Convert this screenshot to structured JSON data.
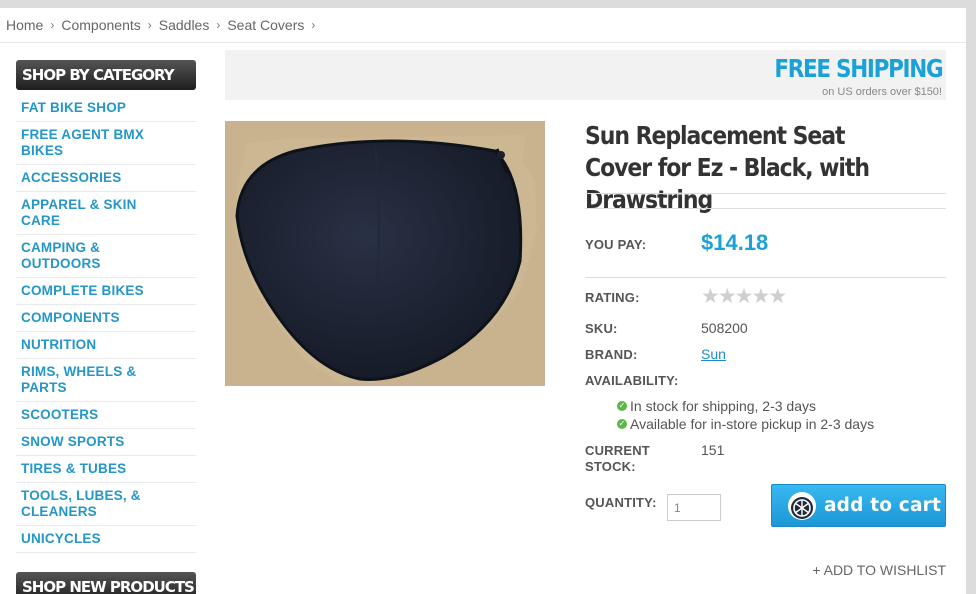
{
  "breadcrumb": [
    "Home",
    "Components",
    "Saddles",
    "Seat Covers"
  ],
  "breadcrumb_separator": "›",
  "sidebar": {
    "header": "Shop by Category",
    "items": [
      "Fat Bike Shop",
      "Free Agent BMX Bikes",
      "Accessories",
      "Apparel & Skin Care",
      "Camping & Outdoors",
      "Complete Bikes",
      "Components",
      "Nutrition",
      "Rims, Wheels & Parts",
      "Scooters",
      "Snow Sports",
      "Tires & Tubes",
      "Tools, Lubes, & Cleaners",
      "Unicycles"
    ],
    "second_header": "Shop New Products"
  },
  "banner": {
    "title": "FREE SHIPPING",
    "subtitle": "on US orders over $150!"
  },
  "product": {
    "title": "Sun Replacement Seat Cover for Ez - Black, with Drawstring",
    "you_pay_label": "You Pay:",
    "price": "$14.18",
    "rating_label": "Rating:",
    "rating_value": 0,
    "rating_max": 5,
    "sku_label": "SKU:",
    "sku": "508200",
    "brand_label": "Brand:",
    "brand": "Sun",
    "availability_label": "Availability:",
    "availability": [
      "In stock for shipping, 2-3 days",
      "Available for in-store pickup in 2-3 days"
    ],
    "stock_label": "Current Stock:",
    "stock": "151",
    "quantity_label": "Quantity:",
    "quantity": "1",
    "add_to_cart": "add to cart",
    "wishlist": "+ Add to Wishlist"
  },
  "colors": {
    "accent": "#1ba1d8",
    "link": "#2496c8",
    "in_stock": "#5cb946"
  },
  "icons": {
    "cart_button": "bike-wheel-icon",
    "availability": "check-circle-icon",
    "rating": "star-icon"
  }
}
